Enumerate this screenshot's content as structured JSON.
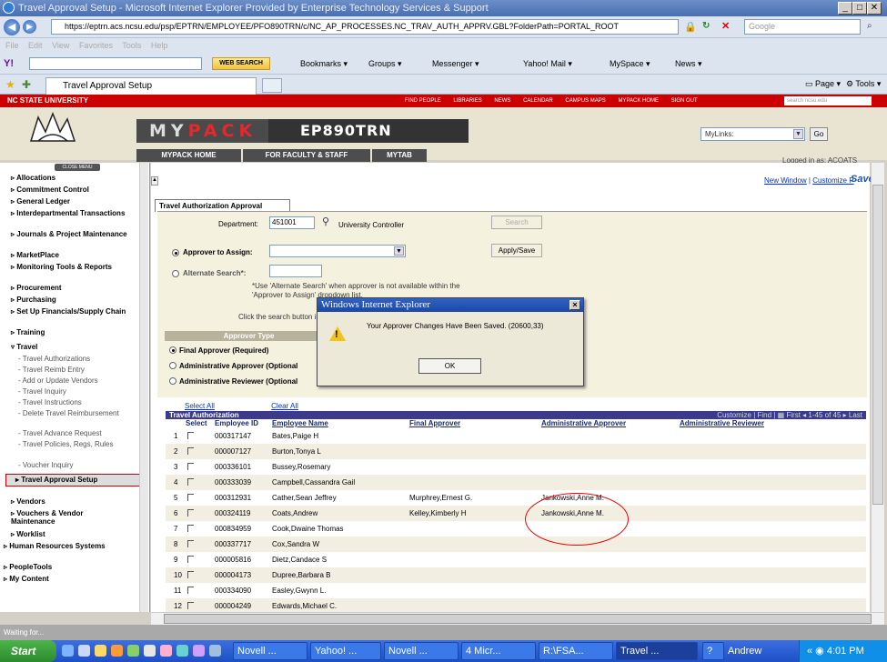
{
  "window": {
    "title": "Travel Approval Setup - Microsoft Internet Explorer Provided by Enterprise Technology Services & Support"
  },
  "browser": {
    "url": "https://eptrn.acs.ncsu.edu/psp/EPTRN/EMPLOYEE/PFO890TRN/c/NC_AP_PROCESSES.NC_TRAV_AUTH_APPRV.GBL?FolderPath=PORTAL_ROOT",
    "search_placeholder": "Google",
    "menu": [
      "File",
      "Edit",
      "View",
      "Favorites",
      "Tools",
      "Help"
    ],
    "toolbar": {
      "web_search": "WEB SEARCH",
      "bookmarks": "Bookmarks",
      "groups": "Groups",
      "messenger": "Messenger",
      "mail": "Yahoo! Mail",
      "myspace": "MySpace",
      "news": "News"
    },
    "tab_title": "Travel Approval Setup",
    "tab_tools": {
      "page": "Page",
      "tools": "Tools"
    }
  },
  "site": {
    "university": "NC STATE UNIVERSITY",
    "top_links": [
      "FIND PEOPLE",
      "LIBRARIES",
      "NEWS",
      "CALENDAR",
      "CAMPUS MAPS",
      "MYPACK HOME",
      "SIGN OUT"
    ],
    "search_placeholder": "search ncsu.edu",
    "logo_my": "MY",
    "logo_pack": "PACK",
    "program": "EP890TRN",
    "mylinks": "MyLinks:",
    "go": "Go",
    "nav": [
      "MYPACK HOME",
      "FOR FACULTY & STAFF",
      "MYTAB"
    ],
    "logged_in": "Logged in as: ACOATS"
  },
  "leftmenu": {
    "close": "CLOSE MENU",
    "top": [
      "Allocations",
      "Commitment Control",
      "General Ledger",
      "Interdepartmental Transactions",
      "Journals & Project Maintenance",
      "MarketPlace",
      "Monitoring Tools & Reports",
      "Procurement",
      "Purchasing",
      "Set Up Financials/Supply Chain",
      "Training",
      "Travel"
    ],
    "travel_items": [
      "Travel Authorizations",
      "Travel Reimb Entry",
      "Add or Update Vendors",
      "Travel Inquiry",
      "Travel Instructions",
      "Delete Travel Reimbursement",
      "Travel Advance Request",
      "Travel Policies, Regs, Rules",
      "Voucher Inquiry"
    ],
    "selected": "Travel Approval Setup",
    "bottom": [
      "Vendors",
      "Vouchers & Vendor Maintenance",
      "Worklist",
      "Human Resources Systems",
      "PeopleTools",
      "My Content"
    ]
  },
  "page": {
    "new_window": "New Window",
    "customize": "Customize P",
    "saved": "Saved",
    "tab": "Travel Authorization Approval",
    "department_label": "Department:",
    "department_value": "451001",
    "department_name": "University Controller",
    "search_btn": "Search",
    "approver_label": "Approver to Assign:",
    "apply_btn": "Apply/Save",
    "alternate_label": "Alternate Search*:",
    "note1": "*Use 'Alternate Search' when approver is not available within the",
    "note2": "'Approver to Assign' dropdown list.",
    "click_note": "Click the search button in order to",
    "approver_type_header": "Approver Type",
    "approver_types": [
      "Final Approver (Required)",
      "Administrative Approver (Optional",
      "Administrative Reviewer (Optional"
    ]
  },
  "dialog": {
    "title": "Windows Internet Explorer",
    "message": "Your Approver Changes Have Been Saved. (20600,33)",
    "ok": "OK"
  },
  "grid": {
    "select_all": "Select All",
    "clear_all": "Clear All",
    "title": "Travel Authorization",
    "nav": "Customize | Find | ▦    First ◂ 1-45 of 45 ▸ Last",
    "columns": [
      "Select",
      "Employee ID",
      "Employee Name",
      "Final Approver",
      "Administrative Approver",
      "Administrative Reviewer"
    ],
    "rows": [
      {
        "n": "1",
        "id": "000317147",
        "name": "Bates,Paige H",
        "final": "",
        "admin": ""
      },
      {
        "n": "2",
        "id": "000007127",
        "name": "Burton,Tonya L",
        "final": "",
        "admin": ""
      },
      {
        "n": "3",
        "id": "000336101",
        "name": "Bussey,Rosemary",
        "final": "",
        "admin": ""
      },
      {
        "n": "4",
        "id": "000333039",
        "name": "Campbell,Cassandra Gail",
        "final": "",
        "admin": ""
      },
      {
        "n": "5",
        "id": "000312931",
        "name": "Cather,Sean Jeffrey",
        "final": "Murphrey,Ernest G.",
        "admin": "Jankowski,Anne M."
      },
      {
        "n": "6",
        "id": "000324119",
        "name": "Coats,Andrew",
        "final": "Kelley,Kimberly H",
        "admin": "Jankowski,Anne M."
      },
      {
        "n": "7",
        "id": "000834959",
        "name": "Cook,Dwaine Thomas",
        "final": "",
        "admin": ""
      },
      {
        "n": "8",
        "id": "000337717",
        "name": "Cox,Sandra W",
        "final": "",
        "admin": ""
      },
      {
        "n": "9",
        "id": "000005816",
        "name": "Dietz,Candace S",
        "final": "",
        "admin": ""
      },
      {
        "n": "10",
        "id": "000004173",
        "name": "Dupree,Barbara B",
        "final": "",
        "admin": ""
      },
      {
        "n": "11",
        "id": "000334090",
        "name": "Easley,Gwynn L.",
        "final": "",
        "admin": ""
      },
      {
        "n": "12",
        "id": "000004249",
        "name": "Edwards,Michael C.",
        "final": "",
        "admin": ""
      }
    ]
  },
  "status": {
    "text": "Waiting for..."
  },
  "taskbar": {
    "start": "Start",
    "tasks": [
      "Novell ...",
      "Yahoo! ...",
      "Novell ...",
      "4 Micr...",
      "R:\\FSA...",
      "Travel ..."
    ],
    "user": "Andrew",
    "clock": "4:01 PM"
  }
}
